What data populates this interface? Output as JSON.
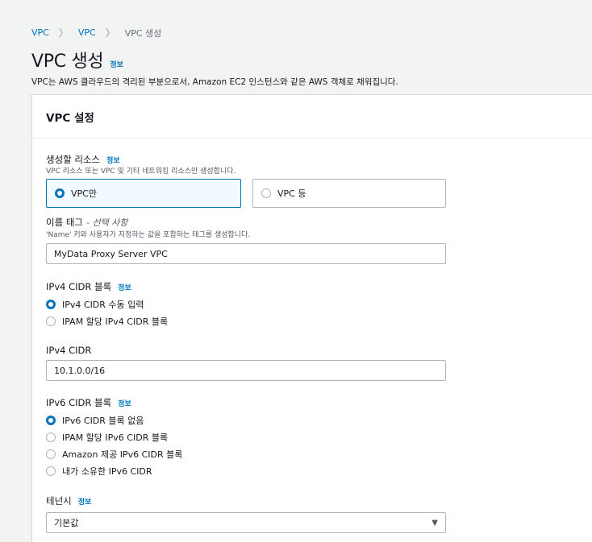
{
  "breadcrumb": [
    "VPC",
    "VPC",
    "VPC 생성"
  ],
  "header": {
    "title": "VPC 생성",
    "info": "정보",
    "description": "VPC는 AWS 클라우드의 격리된 부분으로서, Amazon EC2 인스턴스와 같은 AWS 객체로 채워집니다."
  },
  "panel": {
    "title": "VPC 설정",
    "resources": {
      "label": "생성할 리소스",
      "info": "정보",
      "description": "VPC 리소스 또는 VPC 및 기타 네트워킹 리소스만 생성합니다.",
      "options": [
        "VPC만",
        "VPC 등"
      ],
      "selected": 0
    },
    "name_tag": {
      "label": "이름 태그",
      "optional": "- 선택 사항",
      "description": "'Name' 키와 사용자가 지정하는 값을 포함하는 태그를 생성합니다.",
      "value": "MyData Proxy Server VPC"
    },
    "ipv4_block": {
      "label": "IPv4 CIDR 블록",
      "info": "정보",
      "options": [
        "IPv4 CIDR 수동 입력",
        "IPAM 할당 IPv4 CIDR 블록"
      ],
      "selected": 0
    },
    "ipv4_cidr": {
      "label": "IPv4 CIDR",
      "value": "10.1.0.0/16"
    },
    "ipv6_block": {
      "label": "IPv6 CIDR 블록",
      "info": "정보",
      "options": [
        "IPv6 CIDR 블록 없음",
        "IPAM 할당 IPv6 CIDR 블록",
        "Amazon 제공 IPv6 CIDR 블록",
        "내가 소유한 IPv6 CIDR"
      ],
      "selected": 0
    },
    "tenancy": {
      "label": "테넌시",
      "info": "정보",
      "value": "기본값",
      "caret_icon": "triangle-down-icon"
    }
  },
  "colors": {
    "accent": "#0073bb",
    "background": "#f2f3f3",
    "border": "#aab7b8"
  }
}
